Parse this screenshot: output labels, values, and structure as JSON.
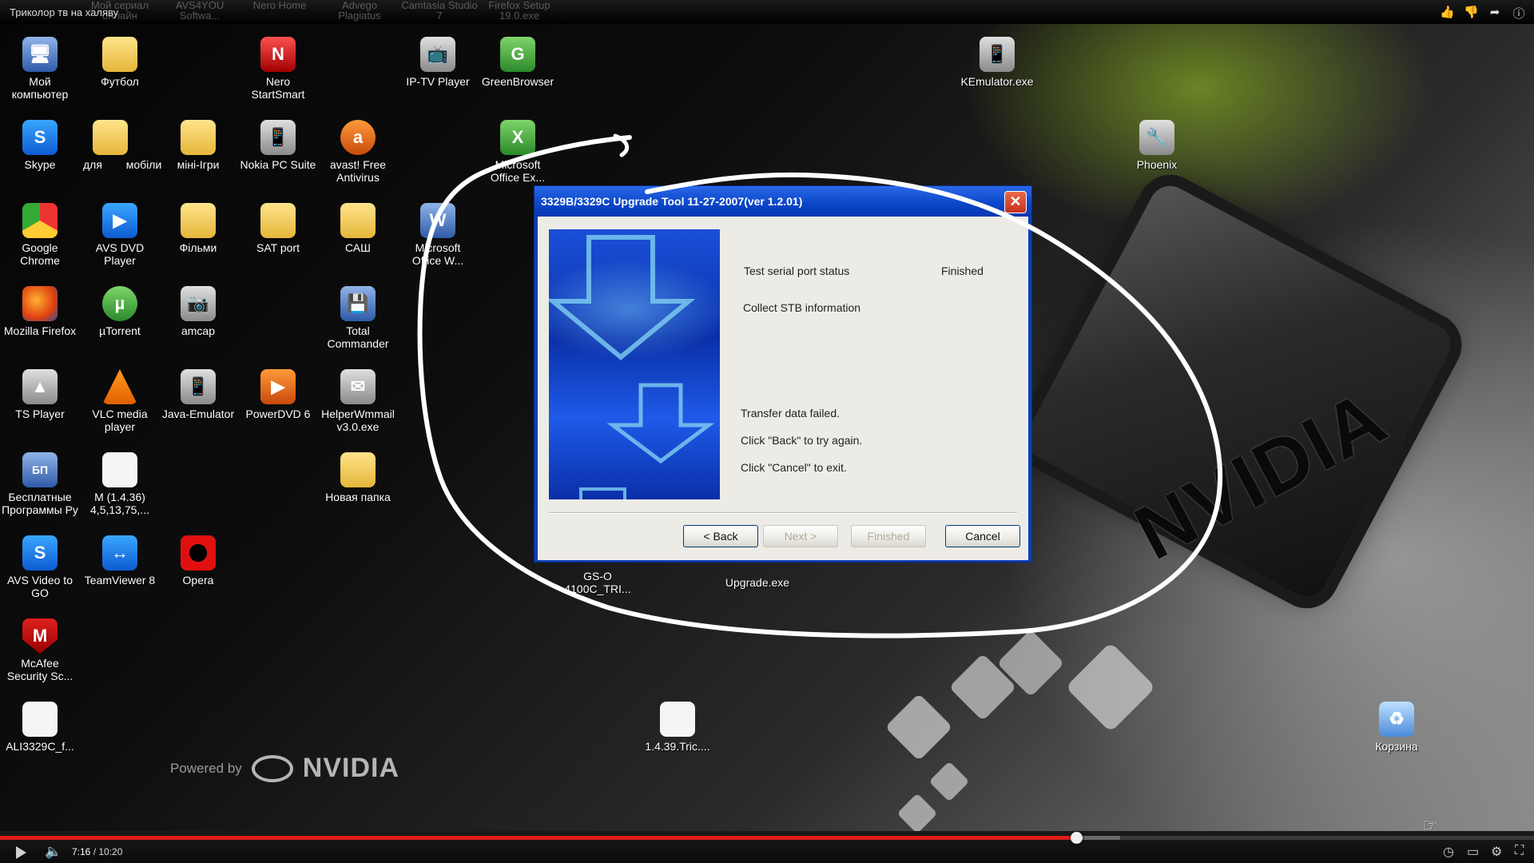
{
  "video": {
    "title": "Триколор тв на халяву",
    "time_current": "7:16",
    "time_total": "10:20",
    "progress": 0.702,
    "buffered": 0.73
  },
  "top_actions": [
    "like-icon",
    "dislike-icon",
    "share-icon",
    "info-icon"
  ],
  "faded_labels": [
    "Мой сериал онлайн",
    "AVS4YOU Softwa...",
    "Nero Home",
    "Advego Plagiatus",
    "Camtasia Studio 7",
    "Firefox Setup 19.0.exe"
  ],
  "desktop_icons": [
    {
      "label": "Мой\nкомпьютер",
      "icon": "computer-icon"
    },
    {
      "label": "Футбол",
      "icon": "folder-icon"
    },
    {
      "label": "Nero\nStartSmart",
      "icon": "nero-icon"
    },
    {
      "label": "IP-TV Player",
      "icon": "iptv-icon"
    },
    {
      "label": "GreenBrowser",
      "icon": "greenbrowser-icon"
    },
    {
      "label": "KEmulator.exe",
      "icon": "kemulator-icon"
    },
    {
      "label": "Skype",
      "icon": "skype-icon"
    },
    {
      "label": "для",
      "icon": "folder-icon"
    },
    {
      "label": "мобіли",
      "icon": "folder-icon"
    },
    {
      "label": "міні-Ігри",
      "icon": "folder-icon"
    },
    {
      "label": "Nokia PC Suite",
      "icon": "nokia-icon"
    },
    {
      "label": "avast! Free\nAntivirus",
      "icon": "avast-icon"
    },
    {
      "label": "Microsoft\nOffice Ex...",
      "icon": "excel-icon"
    },
    {
      "label": "Phoenix",
      "icon": "phoenix-icon"
    },
    {
      "label": "Google\nChrome",
      "icon": "chrome-icon"
    },
    {
      "label": "AVS DVD\nPlayer",
      "icon": "avs-dvd-icon"
    },
    {
      "label": "Фільми",
      "icon": "folder-icon"
    },
    {
      "label": "SAT port",
      "icon": "folder-icon"
    },
    {
      "label": "САШ",
      "icon": "folder-icon"
    },
    {
      "label": "Microsoft\nOffice W...",
      "icon": "word-icon"
    },
    {
      "label": "Mozilla Firefox",
      "icon": "firefox-icon"
    },
    {
      "label": "µTorrent",
      "icon": "utorrent-icon"
    },
    {
      "label": "amcap",
      "icon": "amcap-icon"
    },
    {
      "label": "Total\nCommander",
      "icon": "total-commander-icon"
    },
    {
      "label": "TS Player",
      "icon": "ts-player-icon"
    },
    {
      "label": "VLC media\nplayer",
      "icon": "vlc-icon"
    },
    {
      "label": "Java-Emulator",
      "icon": "java-emulator-icon"
    },
    {
      "label": "PowerDVD 6",
      "icon": "powerdvd-icon"
    },
    {
      "label": "HelperWmmail\nv3.0.exe",
      "icon": "helper-icon"
    },
    {
      "label": "Бесплатные\nПрограммы Ру",
      "icon": "free-programs-icon"
    },
    {
      "label": "M (1.4.36)\n4,5,13,75,...",
      "icon": "file-icon"
    },
    {
      "label": "Новая папка",
      "icon": "folder-icon"
    },
    {
      "label": "AVS Video to\nGO",
      "icon": "avs-video-icon"
    },
    {
      "label": "TeamViewer 8",
      "icon": "teamviewer-icon"
    },
    {
      "label": "Opera",
      "icon": "opera-icon"
    },
    {
      "label": "McAfee\nSecurity Sc...",
      "icon": "mcafee-icon"
    },
    {
      "label": "ALI3329C_f...",
      "icon": "file-icon"
    },
    {
      "label": "1.4.39.Tric....",
      "icon": "file-icon"
    },
    {
      "label": "Корзина",
      "icon": "recycle-bin-icon"
    }
  ],
  "under_dialog_labels": [
    "GS-O\n4100C_TRI...",
    "Upgrade.exe"
  ],
  "branding": {
    "powered_by": "Powered by",
    "brand": "NVIDIA",
    "chip_logo": "NVIDIA",
    "accent": "#76b900"
  },
  "dialog": {
    "title": "3329B/3329C Upgrade Tool 11-27-2007(ver 1.2.01)",
    "status_rows": [
      {
        "label": "Test serial port status",
        "value": "Finished"
      },
      {
        "label": "Collect STB information",
        "value": ""
      }
    ],
    "messages": [
      "Transfer data failed.",
      "Click \"Back\" to  try again.",
      "Click \"Cancel\" to exit."
    ],
    "buttons": {
      "back": "< Back",
      "next": "Next >",
      "finished": "Finished",
      "cancel": "Cancel"
    },
    "titlebar_color": "#0a45c8",
    "close_color": "#c8301a"
  }
}
